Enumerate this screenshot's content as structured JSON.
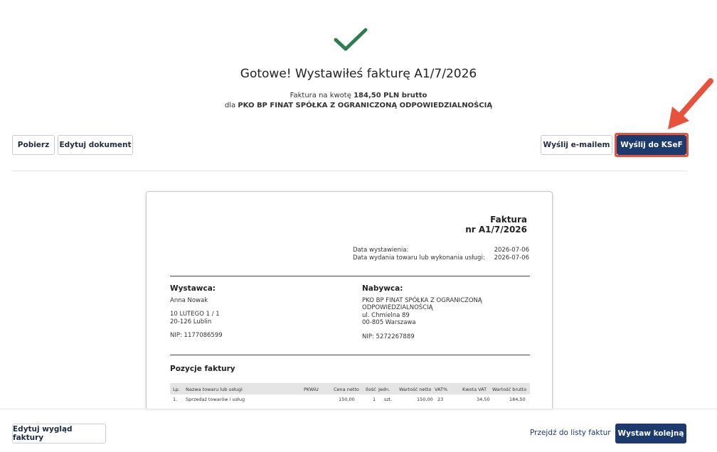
{
  "header": {
    "title": "Gotowe! Wystawiłeś fakturę A1/7/2026",
    "line1_prefix": "Faktura na kwotę",
    "line1_amount": "184,50 PLN brutto",
    "line2_prefix": "dla",
    "line2_company": "PKO BP FINAT SPÓŁKA Z OGRANICZONĄ ODPOWIEDZIALNOŚCIĄ"
  },
  "toolbar": {
    "download": "Pobierz",
    "edit_document": "Edytuj dokument",
    "send_email": "Wyślij e-mailem",
    "send_ksef": "Wyślij do KSeF"
  },
  "invoice": {
    "title": "Faktura",
    "number": "nr A1/7/2026",
    "issue_date_label": "Data wystawienia:",
    "issue_date": "2026-07-06",
    "delivery_date_label": "Data wydania towaru lub wykonania usługi:",
    "delivery_date": "2026-07-06",
    "seller": {
      "heading": "Wystawca:",
      "name": "Anna Nowak",
      "street": "10 LUTEGO 1 / 1",
      "city": "20-126 Lublin",
      "nip": "NIP: 1177086599"
    },
    "buyer": {
      "heading": "Nabywca:",
      "name1": "PKO BP FINAT SPÓŁKA Z OGRANICZONĄ",
      "name2": "ODPOWIEDZIALNOŚCIĄ",
      "street": "ul. Chmielna 89",
      "city": "00-805 Warszawa",
      "nip": "NIP: 5272267889"
    },
    "items_heading": "Pozycje faktury",
    "columns": {
      "lp": "Lp.",
      "name": "Nazwa towaru lub usługi",
      "pkwiu": "PKWiU",
      "net_price": "Cena netto",
      "qty": "Ilość",
      "unit": "Jedn.",
      "net_value": "Wartość netto",
      "vat": "VAT%",
      "vat_amount": "Kwota VAT",
      "gross": "Wartość brutto"
    },
    "rows": [
      {
        "lp": "1.",
        "name": "Sprzedaż towarów i usług",
        "net_price": "150,00",
        "qty": "1",
        "unit": "szt.",
        "net_value": "150,00",
        "vat": "23",
        "vat_amount": "34,50",
        "gross": "184,50"
      }
    ]
  },
  "footer": {
    "edit_layout": "Edytuj wygląd faktury",
    "go_to_list": "Przejdź do listy faktur",
    "issue_next": "Wystaw kolejną"
  },
  "colors": {
    "check": "#2e7d4f",
    "primary": "#1c3a6e",
    "highlight": "#e8523a"
  },
  "icons": {
    "success": "check-icon",
    "pointer": "arrow-icon"
  }
}
